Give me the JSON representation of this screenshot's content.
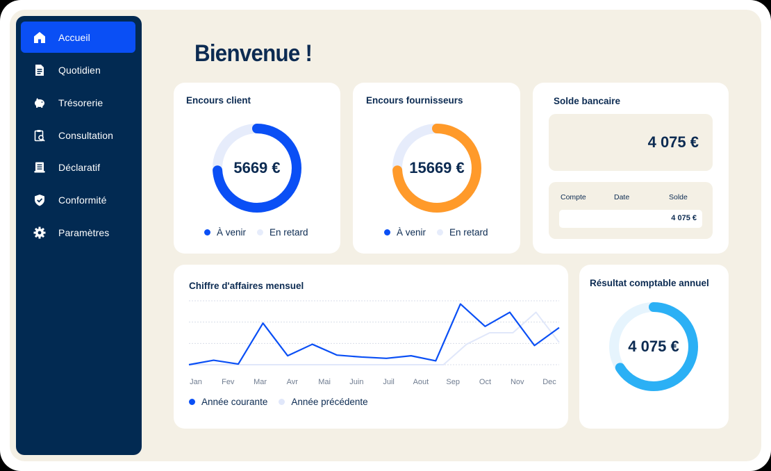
{
  "sidebar": {
    "items": [
      {
        "label": "Accueil",
        "icon": "home-icon",
        "active": true
      },
      {
        "label": "Quotidien",
        "icon": "document-icon",
        "active": false
      },
      {
        "label": "Trésorerie",
        "icon": "piggy-bank-icon",
        "active": false
      },
      {
        "label": "Consultation",
        "icon": "clipboard-search-icon",
        "active": false
      },
      {
        "label": "Déclaratif",
        "icon": "form-icon",
        "active": false
      },
      {
        "label": "Conformité",
        "icon": "shield-check-icon",
        "active": false
      },
      {
        "label": "Paramètres",
        "icon": "gear-icon",
        "active": false
      }
    ]
  },
  "header": {
    "title": "Bienvenue !"
  },
  "cards": {
    "client": {
      "title": "Encours client",
      "value": "5669 €",
      "progress": 0.74,
      "color": "#0a4ff5",
      "track": "#e6ecfb",
      "legend": [
        "À venir",
        "En retard"
      ]
    },
    "supplier": {
      "title": "Encours fournisseurs",
      "value": "15669 €",
      "progress": 0.74,
      "color": "#ff9a2a",
      "track": "#e6ecfb",
      "legend": [
        "À venir",
        "En retard"
      ]
    },
    "bank": {
      "title": "Solde bancaire",
      "amount": "4 075 €",
      "columns": [
        "Compte",
        "Date",
        "Solde"
      ],
      "row_value": "4 075 €"
    },
    "result": {
      "title": "Résultat comptable annuel",
      "value": "4 075 €",
      "progress": 0.66,
      "color": "#2bb0f5",
      "track": "#e6f4fd"
    }
  },
  "legend_colors": {
    "upcoming": "#0a4ff5",
    "late": "#e6ecfb"
  },
  "chart_data": {
    "type": "line",
    "title": "Chiffre d'affaires mensuel",
    "categories": [
      "Jan",
      "Fev",
      "Mar",
      "Avr",
      "Mai",
      "Juin",
      "Juil",
      "Aout",
      "Sep",
      "Oct",
      "Nov",
      "Dec"
    ],
    "ylim": [
      0,
      100
    ],
    "grid": true,
    "legend_position": "bottom-left",
    "series": [
      {
        "name": "Année courante",
        "color": "#0a4ff5",
        "values": [
          0,
          7,
          1,
          65,
          14,
          32,
          15,
          12,
          10,
          14,
          6,
          95,
          60,
          82,
          30,
          58
        ]
      },
      {
        "name": "Année précédente",
        "color": "#e0e7fa",
        "values": [
          0,
          0,
          0,
          0,
          0,
          0,
          0,
          0,
          0,
          0,
          0,
          0,
          32,
          50,
          50,
          82,
          35
        ]
      }
    ]
  }
}
